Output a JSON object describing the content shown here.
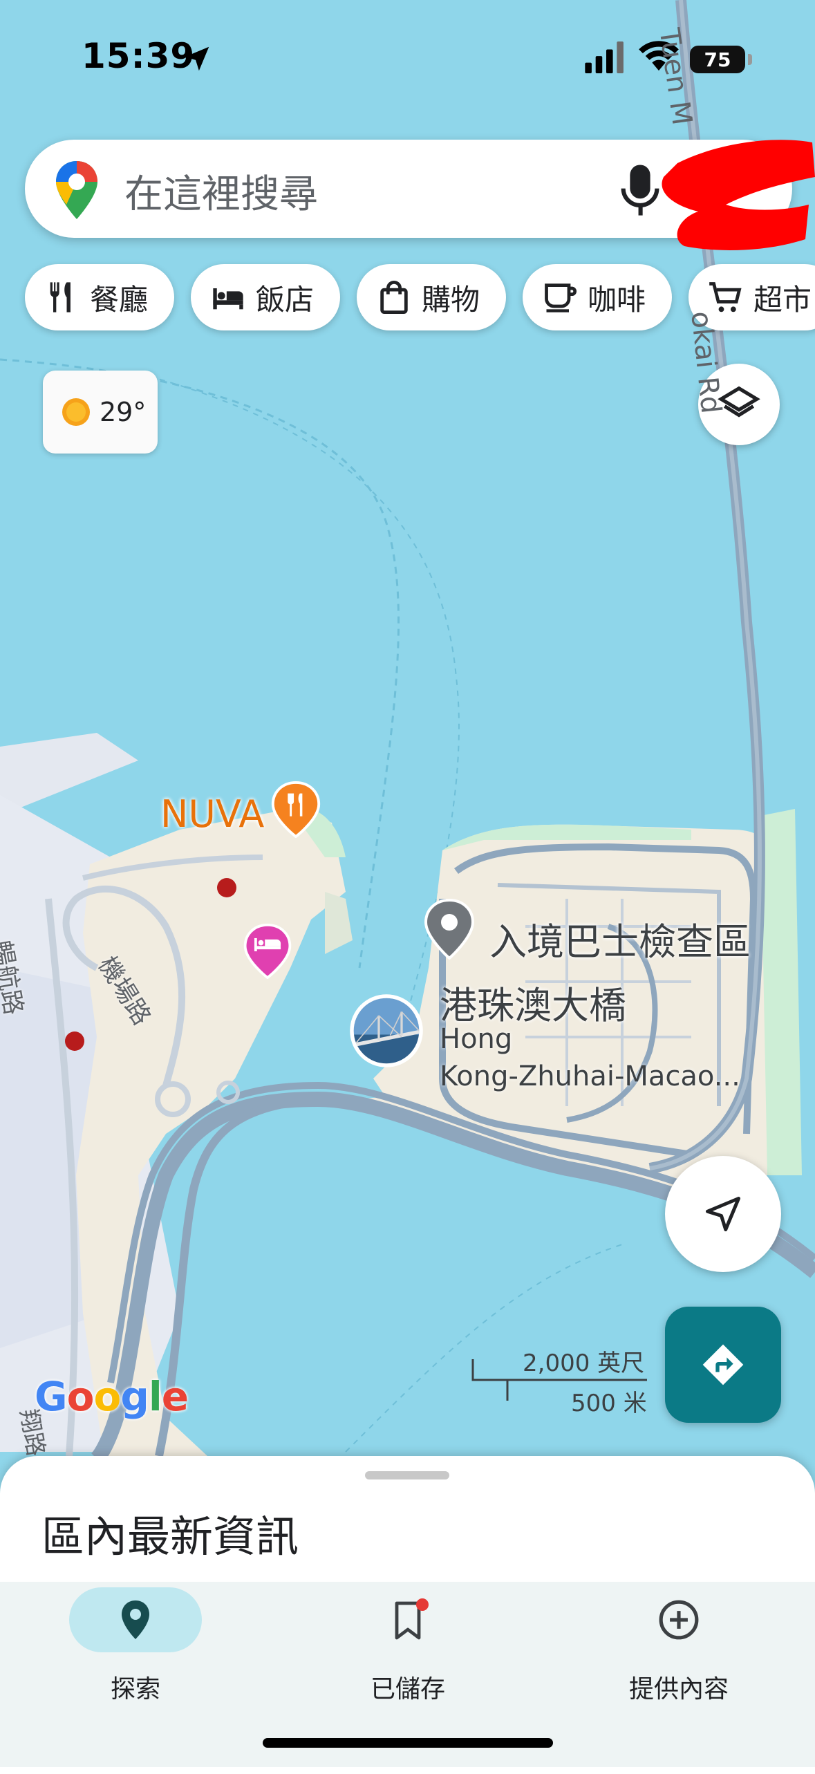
{
  "status_bar": {
    "time": "15:39",
    "battery": "75"
  },
  "search": {
    "placeholder": "在這裡搜尋"
  },
  "chips": [
    {
      "label": "餐廳",
      "icon": "restaurant-icon"
    },
    {
      "label": "飯店",
      "icon": "hotel-icon"
    },
    {
      "label": "購物",
      "icon": "shopping-bag-icon"
    },
    {
      "label": "咖啡",
      "icon": "coffee-icon"
    },
    {
      "label": "超市",
      "icon": "cart-icon"
    }
  ],
  "weather": {
    "temperature": "29°",
    "icon": "sun-icon"
  },
  "map": {
    "places": {
      "nuva": "NUVA",
      "bus_checkpoint": "入境巴士檢查區",
      "bridge_zh": "港珠澳大橋",
      "bridge_en_line1": "Hong",
      "bridge_en_line2": "Kong-Zhuhai-Macao..."
    },
    "roads": {
      "airport_road": "機場路",
      "chang_hang_road": "暢航路",
      "tuen_mun_a": "Tuen M",
      "tuen_mun_b": "okai Rd",
      "lower_road": "翔路"
    },
    "attribution": "Google",
    "scale": {
      "feet": "2,000 英尺",
      "meters": "500 米"
    }
  },
  "sheet": {
    "title": "區內最新資訊"
  },
  "tabs": [
    {
      "label": "探索",
      "icon": "explore-pin-icon",
      "active": true
    },
    {
      "label": "已儲存",
      "icon": "bookmark-icon",
      "active": false,
      "badge": true
    },
    {
      "label": "提供內容",
      "icon": "add-circle-icon",
      "active": false
    }
  ],
  "colors": {
    "water": "#8fd6ea",
    "land": "#f1ece0",
    "road": "#8ea6bd",
    "accent_teal": "#0b7a86",
    "nuva_orange": "#e8710a",
    "hotel_pink": "#e040b0"
  }
}
